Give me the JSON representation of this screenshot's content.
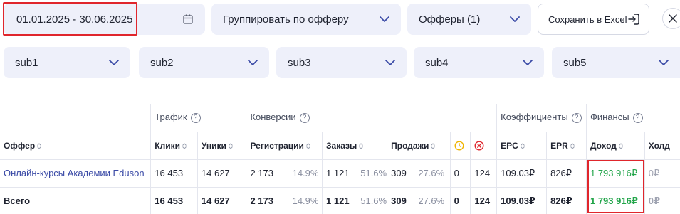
{
  "filters": {
    "date_range": "01.01.2025 - 30.06.2025",
    "group_by": "Группировать по офферу",
    "offers": "Офферы (1)",
    "export_label": "Сохранить в Excel",
    "sub1": "sub1",
    "sub2": "sub2",
    "sub3": "sub3",
    "sub4": "sub4",
    "sub5": "sub5"
  },
  "table": {
    "groups": {
      "traffic": "Трафик",
      "conversions": "Конверсии",
      "coefficients": "Коэффициенты",
      "finance": "Финансы"
    },
    "headers": {
      "offer": "Оффер",
      "clicks": "Клики",
      "uniques": "Уники",
      "registrations": "Регистрации",
      "orders": "Заказы",
      "sales": "Продажи",
      "epc": "EPC",
      "epr": "EPR",
      "income": "Доход",
      "hold": "Холд"
    },
    "rows": [
      {
        "offer": "Онлайн-курсы Академии Eduson",
        "clicks": "16 453",
        "uniques": "14 627",
        "registrations": "2 173",
        "registrations_pct": "14.9%",
        "orders": "1 121",
        "orders_pct": "51.6%",
        "sales": "309",
        "sales_pct": "27.6%",
        "pending": "0",
        "rejected": "124",
        "epc": "109.03₽",
        "epr": "826₽",
        "income": "1 793 916₽",
        "hold": "0₽"
      }
    ],
    "total": {
      "offer": "Всего",
      "clicks": "16 453",
      "uniques": "14 627",
      "registrations": "2 173",
      "registrations_pct": "14.9%",
      "orders": "1 121",
      "orders_pct": "51.6%",
      "sales": "309",
      "sales_pct": "27.6%",
      "pending": "0",
      "rejected": "124",
      "epc": "109.03₽",
      "epr": "826₽",
      "income": "1 793 916₽",
      "hold": "0₽"
    }
  },
  "colors": {
    "accent": "#3a4aa6",
    "control_bg": "#eef0fa",
    "highlight": "#e0262c",
    "income": "#22a54a",
    "pending_icon": "#f0b400",
    "rejected_icon": "#e0262c"
  },
  "icons": {
    "calendar": "calendar-icon",
    "chevron": "chevron-down-icon",
    "export": "export-icon",
    "close": "close-icon",
    "help": "help-circle-icon",
    "sort": "sort-icon",
    "pending": "clock-icon",
    "rejected": "cancel-circle-icon"
  }
}
